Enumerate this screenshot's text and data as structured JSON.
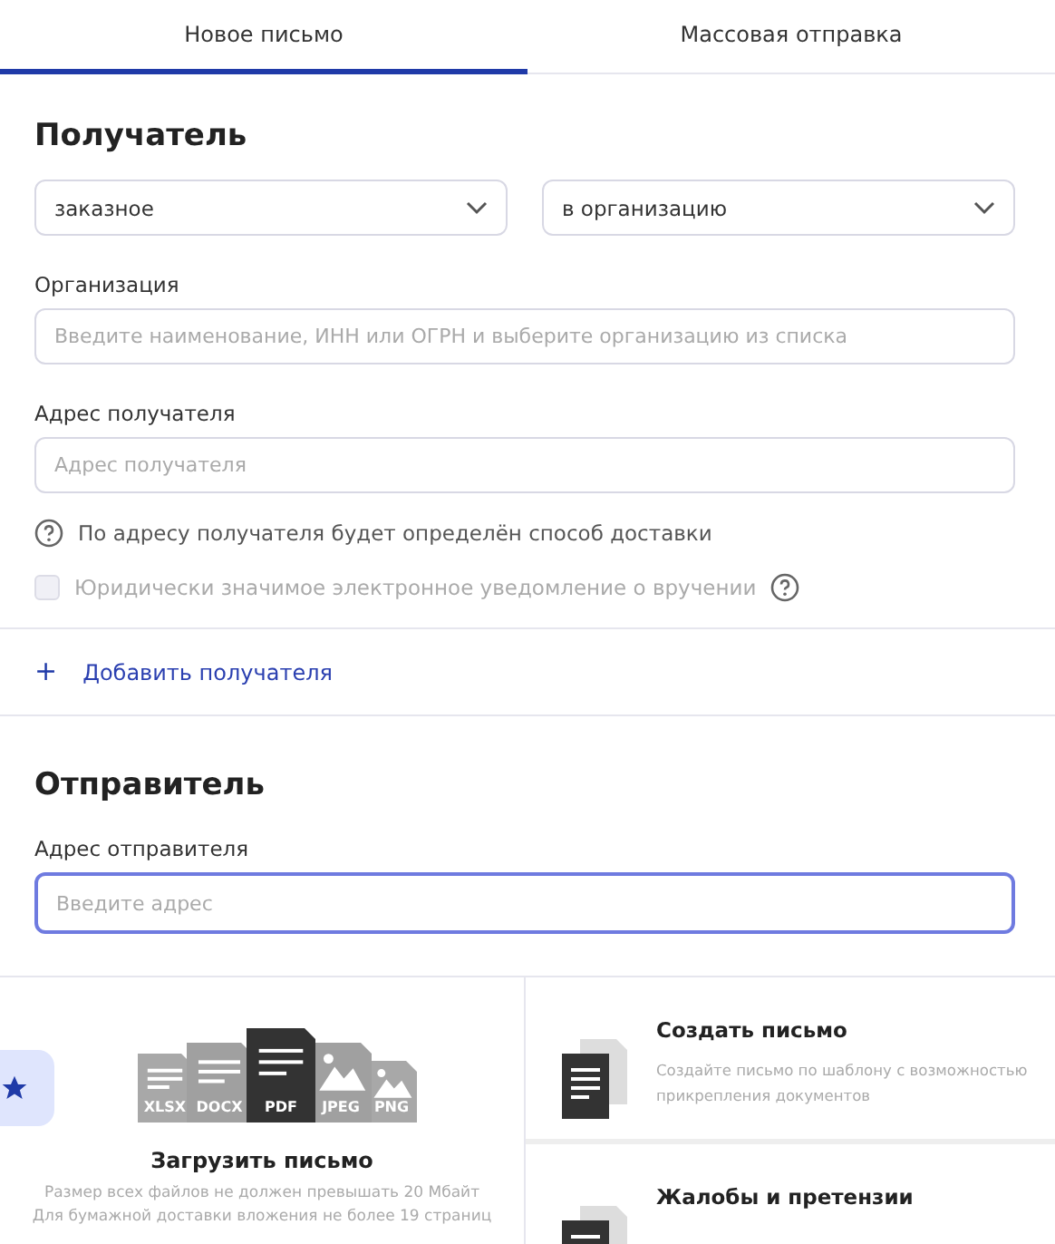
{
  "tabs": [
    {
      "label": "Новое письмо",
      "selected": true
    },
    {
      "label": "Массовая отправка",
      "selected": false
    }
  ],
  "recipient": {
    "heading": "Получатель",
    "selects": [
      {
        "value": "заказное"
      },
      {
        "value": "в организацию"
      }
    ],
    "fields": [
      {
        "label": "Организация",
        "placeholder": "Введите наименование, ИНН или ОГРН и выберите организацию из списка",
        "focused": false
      },
      {
        "label": "Адрес получателя",
        "placeholder": "Адрес получателя",
        "focused": false
      }
    ],
    "hint": "По адресу получателя будет определён способ доставки",
    "notice": {
      "label": "Юридически значимое электронное уведомление о вручении",
      "checked": false,
      "disabled": true
    },
    "add_link": {
      "icon": "+",
      "label": "Добавить получателя"
    }
  },
  "sender": {
    "heading": "Отправитель",
    "fields": [
      {
        "label": "Адрес отправителя",
        "placeholder": "Введите адрес",
        "focused": true
      }
    ]
  },
  "upload": {
    "file_types": [
      {
        "label": "XLSX",
        "kind": "doc"
      },
      {
        "label": "DOCX",
        "kind": "doc"
      },
      {
        "label": "PDF",
        "kind": "doc"
      },
      {
        "label": "JPEG",
        "kind": "image"
      },
      {
        "label": "PNG",
        "kind": "image"
      }
    ],
    "title": "Загрузить письмо",
    "notes": [
      "Размер всех файлов не должен превышать 20 Мбайт",
      "Для бумажной доставки вложения не более 19 страниц"
    ]
  },
  "actions": [
    {
      "title": "Создать письмо",
      "description": "Создайте письмо по шаблону с возможностью прикрепления документов"
    },
    {
      "title": "Жалобы и претензии"
    }
  ]
}
